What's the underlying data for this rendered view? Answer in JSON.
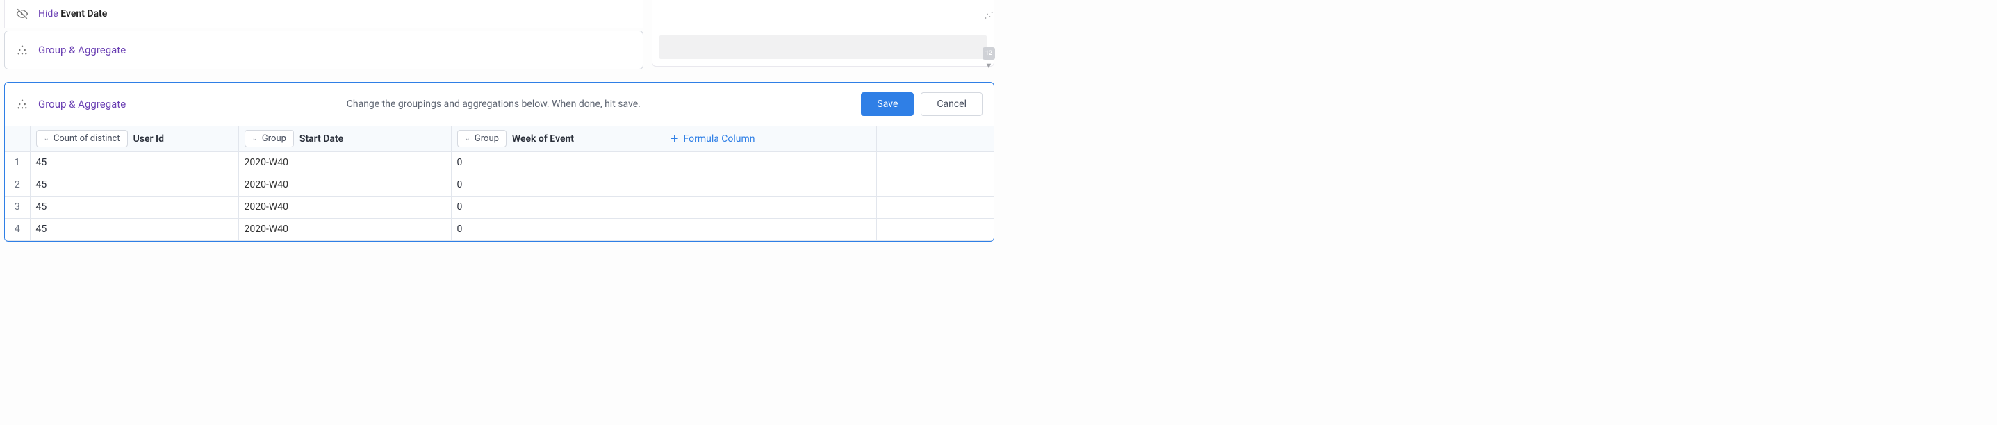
{
  "hide": {
    "prefix": "Hide",
    "field": "Event Date"
  },
  "group_step": {
    "label": "Group & Aggregate"
  },
  "editor": {
    "title": "Group & Aggregate",
    "description": "Change the groupings and aggregations below. When done, hit save.",
    "save": "Save",
    "cancel": "Cancel"
  },
  "columns": {
    "count_pill": "Count of distinct",
    "count_label": "User Id",
    "group_pill": "Group",
    "start_label": "Start Date",
    "week_label": "Week of Event",
    "formula_label": "Formula Column"
  },
  "rows": [
    {
      "n": "1",
      "count": "45",
      "start": "2020-W40",
      "week": "0"
    },
    {
      "n": "2",
      "count": "45",
      "start": "2020-W40",
      "week": "0"
    },
    {
      "n": "3",
      "count": "45",
      "start": "2020-W40",
      "week": "0"
    },
    {
      "n": "4",
      "count": "45",
      "start": "2020-W40",
      "week": "0"
    }
  ],
  "rail": {
    "badge": "12"
  }
}
